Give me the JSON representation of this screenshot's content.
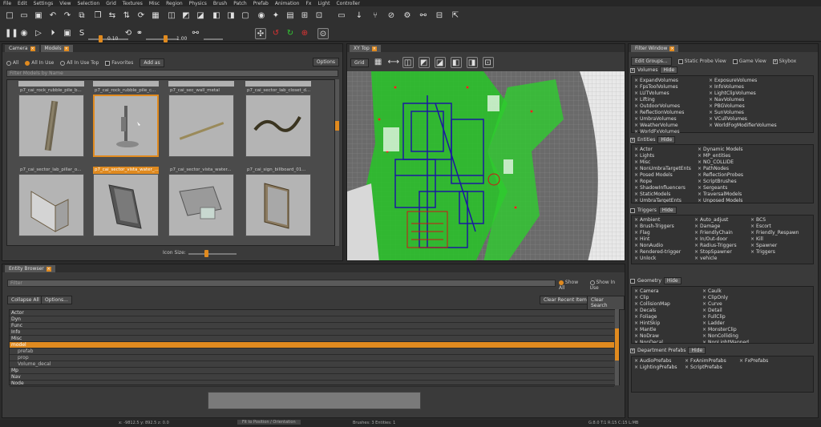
{
  "menu": [
    "File",
    "Edit",
    "Settings",
    "View",
    "Selection",
    "Grid",
    "Textures",
    "Misc",
    "Region",
    "Physics",
    "Brush",
    "Patch",
    "Prefab",
    "Animation",
    "Fx",
    "Light",
    "Controller"
  ],
  "toolbar": {
    "snap1_value": "0.10",
    "snap2_value": "1.00",
    "snap_label": "S"
  },
  "models_panel": {
    "tabs": [
      "Camera",
      "Models"
    ],
    "radio_options": [
      "All",
      "All In Use",
      "All In Use Top"
    ],
    "favorites_label": "Favorites",
    "add_as_label": "Add as",
    "options_label": "Options",
    "filter_placeholder": "Filter Models by Name",
    "top_labels": [
      "p7_cai_rock_rubble_pile_b...",
      "p7_cai_rock_rubble_pile_c...",
      "p7_cai_sec_wall_metal",
      "p7_cai_sector_lab_closet_d..."
    ],
    "bottom_labels": [
      "p7_cai_sector_lab_pillar_o...",
      "p7_cai_sector_vista_water...",
      "p7_cai_sector_vista_water...",
      "p7_cai_sign_billboard_01..."
    ],
    "selected_label": "p7_cai_sector_vista_water_...",
    "icon_size_label": "Icon Size:"
  },
  "xy_view": {
    "tab": "XY Top",
    "grid_label": "Grid"
  },
  "filter_window": {
    "tab": "Filter Window",
    "edit_groups": "Edit Groups...",
    "static_probe": "Static Probe View",
    "game_view": "Game View",
    "skybox": "Skybox",
    "hide": "Hide",
    "sections": {
      "volumes": {
        "title": "Volumes",
        "col1": [
          "ExpandVolumes",
          "FpsToolVolumes",
          "LUTVolumes",
          "Lifting",
          "OutdoorVolumes",
          "ReflectionVolumes",
          "UmbraVolumes",
          "WeatherVolume",
          "WorldFxVolumes"
        ],
        "col2": [
          "ExposureVolumes",
          "InfoVolumes",
          "LightClipVolumes",
          "NavVolumes",
          "PBGVolumes",
          "SunVolumes",
          "VCullVolumes",
          "WorldFogModifierVolumes"
        ]
      },
      "entities": {
        "title": "Entities",
        "col1": [
          "Actor",
          "Lights",
          "Misc",
          "NonUmbraTargetEnts",
          "Posed Models",
          "Rope",
          "ShadowInfluencers",
          "StaticModels",
          "UmbraTargetEnts",
          "VolumeDecals"
        ],
        "col2": [
          "Dynamic Models",
          "MP_entities",
          "NO_COLLIDE",
          "PathNodes",
          "ReflectionProbes",
          "ScriptBrushes",
          "Sergeants",
          "TraversalModels",
          "Unposed Models",
          "Weapons"
        ]
      },
      "triggers": {
        "title": "Triggers",
        "col1": [
          "Ambient",
          "Brush-Triggers",
          "Flag",
          "Hint",
          "NonAudio",
          "Rendered-trigger",
          "Unlock"
        ],
        "col2": [
          "Auto_adjust",
          "Damage",
          "FriendlyChain",
          "In/Out-door",
          "Radius-Triggers",
          "StopSpawner",
          "vehicle"
        ],
        "col3": [
          "BCS",
          "Escort",
          "Friendly_Respawn",
          "Kill",
          "Spawner",
          "Triggers"
        ]
      },
      "geometry": {
        "title": "Geometry",
        "col1": [
          "Camera",
          "Clip",
          "CollisionMap",
          "Decals",
          "Foliage",
          "HintSkip",
          "Mantle",
          "NoDraw",
          "NonDecal"
        ],
        "col2": [
          "Caulk",
          "ClipOnly",
          "Curve",
          "Detail",
          "FullClip",
          "Ladder",
          "MonsterClip",
          "NonColliding",
          "NonLightMapped"
        ]
      },
      "dept_prefabs": {
        "title": "Department Prefabs",
        "col1": [
          "AudioPrefabs",
          "LightingPrefabs"
        ],
        "col2": [
          "FxAnimPrefabs",
          "ScriptPrefabs"
        ],
        "col3": [
          "FxPrefabs"
        ]
      }
    }
  },
  "entity_browser": {
    "tab": "Entity Browser",
    "filter_placeholder": "Filter",
    "show_all": "Show All",
    "show_in_use": "Show In Use",
    "collapse_all": "Collapse All",
    "options": "Options...",
    "clear_recent": "Clear Recent Items",
    "clear_search": "Clear Search",
    "rows": [
      {
        "label": "Actor",
        "kind": "normal"
      },
      {
        "label": "Dyn",
        "kind": "normal"
      },
      {
        "label": "Func",
        "kind": "normal"
      },
      {
        "label": "Info",
        "kind": "normal"
      },
      {
        "label": "Misc",
        "kind": "normal"
      },
      {
        "label": "model",
        "kind": "sel"
      },
      {
        "label": "prefab",
        "kind": "child"
      },
      {
        "label": "prop",
        "kind": "child"
      },
      {
        "label": "Volume_decal",
        "kind": "child"
      },
      {
        "label": "Mp",
        "kind": "normal"
      },
      {
        "label": "Nav",
        "kind": "normal"
      },
      {
        "label": "Node",
        "kind": "normal"
      }
    ]
  },
  "status": {
    "left": "x: -9812.5 y: 892.5 z: 0.0",
    "center": "Fit to Position / Orientation",
    "mid": "Brushes: 3 Entities: 1",
    "right": "G:8.0 T:1 R:15 C:15 L:MB"
  },
  "colors": {
    "accent": "#e08a1f"
  }
}
